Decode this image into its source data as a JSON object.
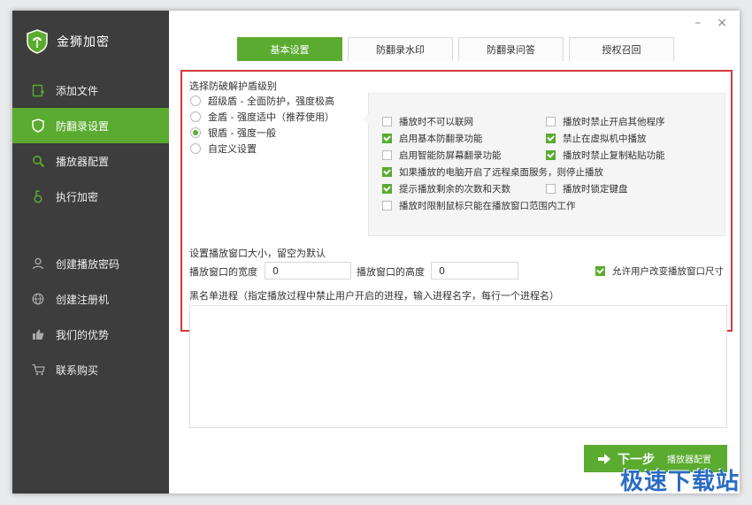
{
  "app": {
    "title": "金狮加密",
    "accent": "#5aab2f"
  },
  "sidebar": {
    "items": [
      {
        "label": "添加文件",
        "icon": "add-file-icon",
        "active": false
      },
      {
        "label": "防翻录设置",
        "icon": "shield-icon",
        "active": true
      },
      {
        "label": "播放器配置",
        "icon": "search-icon",
        "active": false
      },
      {
        "label": "执行加密",
        "icon": "lock-run-icon",
        "active": false
      }
    ],
    "items2": [
      {
        "label": "创建播放密码",
        "icon": "user-icon"
      },
      {
        "label": "创建注册机",
        "icon": "globe-icon"
      },
      {
        "label": "我们的优势",
        "icon": "thumb-up-icon"
      },
      {
        "label": "联系购买",
        "icon": "cart-icon"
      }
    ]
  },
  "window_controls": {
    "minimize": "–",
    "close": "×"
  },
  "tabs": [
    {
      "label": "基本设置",
      "active": true
    },
    {
      "label": "防翻录水印",
      "active": false
    },
    {
      "label": "防翻录问答",
      "active": false
    },
    {
      "label": "授权召回",
      "active": false
    }
  ],
  "level": {
    "title": "选择防破解护盾级别",
    "options": [
      {
        "label": "超级盾 - 全面防护，强度极高",
        "selected": false
      },
      {
        "label": "金盾 - 强度适中（推荐使用）",
        "selected": false
      },
      {
        "label": "银盾 - 强度一般",
        "selected": true
      },
      {
        "label": "自定义设置",
        "selected": false
      }
    ]
  },
  "options": {
    "left": [
      {
        "label": "播放时不可以联网",
        "checked": false
      },
      {
        "label": "启用基本防翻录功能",
        "checked": true
      },
      {
        "label": "启用智能防屏幕翻录功能",
        "checked": false
      }
    ],
    "right": [
      {
        "label": "播放时禁止开启其他程序",
        "checked": false
      },
      {
        "label": "禁止在虚拟机中播放",
        "checked": true
      },
      {
        "label": "播放时禁止复制粘贴功能",
        "checked": true
      }
    ],
    "remote": {
      "label": "如果播放的电脑开启了远程桌面服务，则停止播放",
      "checked": true
    },
    "remaining": {
      "label": "提示播放剩余的次数和天数",
      "checked": true
    },
    "lock_keyboard": {
      "label": "播放时锁定键盘",
      "checked": false
    },
    "mouse_limit": {
      "label": "播放时限制鼠标只能在播放窗口范围内工作",
      "checked": false
    }
  },
  "window_size": {
    "title": "设置播放窗口大小，留空为默认",
    "width_label": "播放窗口的宽度",
    "width_value": "0",
    "height_label": "播放窗口的高度",
    "height_value": "0",
    "allow_resize": {
      "label": "允许用户改变播放窗口尺寸",
      "checked": true
    }
  },
  "blacklist": {
    "title": "黑名单进程（指定播放过程中禁止用户开启的进程，输入进程名字，每行一个进程名）",
    "value": ""
  },
  "next_button": {
    "label": "下一步",
    "sub_label": "播放器配置"
  },
  "watermark": "极速下载站"
}
